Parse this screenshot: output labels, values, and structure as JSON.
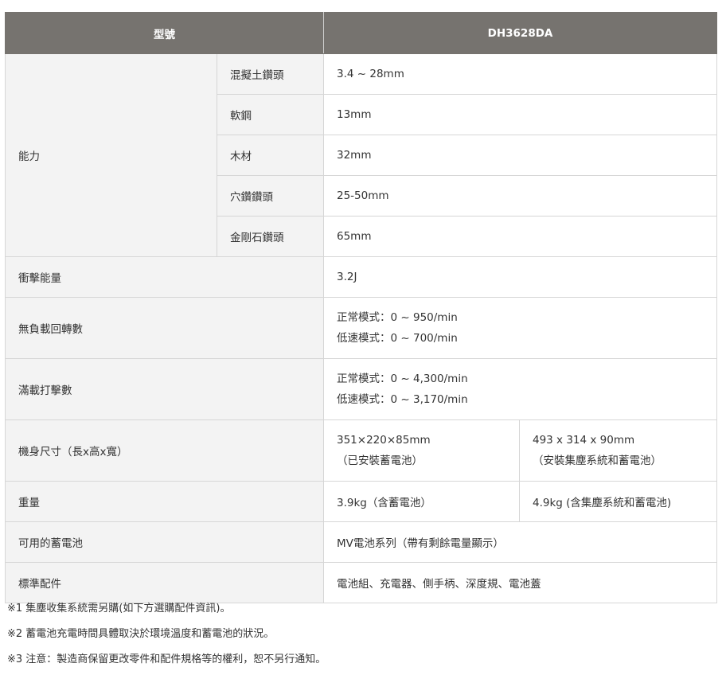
{
  "header": {
    "model_label": "型號",
    "model_value": "DH3628DA"
  },
  "capacity": {
    "label": "能力",
    "rows": [
      {
        "sub": "混擬土鑽頭",
        "value": "3.4 ~ 28mm"
      },
      {
        "sub": "軟鋼",
        "value": "13mm"
      },
      {
        "sub": "木材",
        "value": "32mm"
      },
      {
        "sub": "穴鑽鑽頭",
        "value": "25-50mm"
      },
      {
        "sub": "金剛石鑽頭",
        "value": "65mm"
      }
    ]
  },
  "impact_energy": {
    "label": "衝擊能量",
    "value": "3.2J"
  },
  "no_load_speed": {
    "label": "無負載回轉數",
    "line1": "正常模式：0 ~ 950/min",
    "line2": "低速模式：0 ~ 700/min"
  },
  "full_load_blows": {
    "label": "滿載打擊數",
    "line1": "正常模式：0 ~ 4,300/min",
    "line2": "低速模式：0 ~ 3,170/min"
  },
  "dimensions": {
    "label": "機身尺寸（長x高x寬）",
    "a_line1": "351×220×85mm",
    "a_line2": "（已安裝蓄電池）",
    "b_line1": "493 x 314 x 90mm",
    "b_line2": "（安裝集塵系統和蓄電池）"
  },
  "weight": {
    "label": "重量",
    "a": "3.9kg（含蓄電池）",
    "b": "4.9kg (含集塵系統和蓄電池)"
  },
  "battery": {
    "label": "可用的蓄電池",
    "value": "MV電池系列（帶有剩餘電量顯示）"
  },
  "accessories": {
    "label": "標準配件",
    "value": "電池組、充電器、側手柄、深度規、電池蓋"
  },
  "notes": [
    "※1  集塵收集系統需另購(如下方選購配件資訊)。",
    "※2  蓄電池充電時間具體取決於環境溫度和蓄電池的狀況。",
    "※3  注意：製造商保留更改零件和配件規格等的權利，恕不另行通知。"
  ]
}
